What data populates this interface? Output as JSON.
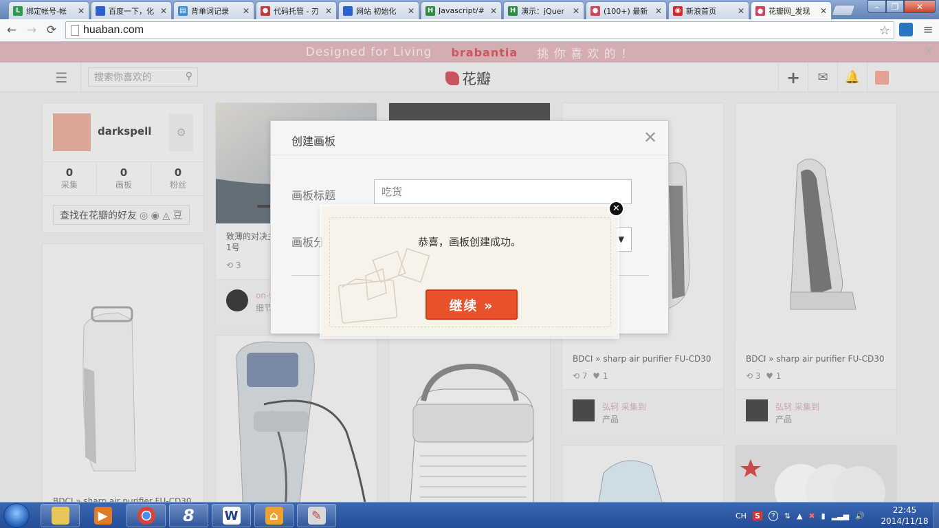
{
  "browser": {
    "tabs": [
      {
        "title": "绑定帐号-帐",
        "fav_color": "#2d9a4d",
        "fav_char": "L"
      },
      {
        "title": "百度一下，化",
        "fav_color": "#2f5fd0",
        "fav_char": "🐾"
      },
      {
        "title": "背单词记录",
        "fav_color": "#3a8ed8",
        "fav_char": "▤"
      },
      {
        "title": "代码托管 - 刃",
        "fav_color": "#c8363c",
        "fav_char": "●"
      },
      {
        "title": "网站 初始化",
        "fav_color": "#2f5fd0",
        "fav_char": "🐾"
      },
      {
        "title": "Javascript/#",
        "fav_color": "#2c8c40",
        "fav_char": "H"
      },
      {
        "title": "演示：jQuer",
        "fav_color": "#2c8c40",
        "fav_char": "H"
      },
      {
        "title": "(100+) 最新",
        "fav_color": "#d24457",
        "fav_char": "●"
      },
      {
        "title": "新浪首页",
        "fav_color": "#d8282e",
        "fav_char": "◉"
      },
      {
        "title": "花瓣网_发现",
        "fav_color": "#d24457",
        "fav_char": "●",
        "active": true
      }
    ],
    "url": "huaban.com"
  },
  "banner": {
    "left": "Designed for Living",
    "brand": "brabantia",
    "right": "挑 你 喜 欢 的 ！"
  },
  "header": {
    "search_placeholder": "搜索你喜欢的",
    "logo_text": "花瓣"
  },
  "profile": {
    "username": "darkspell",
    "stats": [
      {
        "value": "0",
        "label": "采集"
      },
      {
        "value": "0",
        "label": "画板"
      },
      {
        "value": "0",
        "label": "粉丝"
      }
    ],
    "find_friends": "查找在花瓣的好友"
  },
  "pins": {
    "phone": {
      "desc": "致薄的对决主",
      "desc2": "1号",
      "repins": "3",
      "user1": "on-f",
      "user2": "细节"
    },
    "sharp1": {
      "desc": "BDCI » sharp air purifier FU-CD30",
      "repins": "7",
      "likes": "1",
      "user": "弘轲 采集到",
      "board": "产品"
    },
    "sharp2": {
      "desc": "BDCI » sharp air purifier FU-CD30",
      "repins": "3",
      "likes": "1",
      "user": "弘轲 采集到",
      "board": "产品"
    },
    "bottom_left": {
      "desc": "BDCI » sharp air purifier FU-CD30"
    }
  },
  "create_board_modal": {
    "title": "创建画板",
    "title_label": "画板标题",
    "title_value": "吃货",
    "category_label": "画板分"
  },
  "success_popup": {
    "message": "恭喜，画板创建成功。",
    "continue_label": "继续 »"
  },
  "taskbar": {
    "lang": "CH",
    "time": "22:45",
    "date": "2014/11/18"
  }
}
